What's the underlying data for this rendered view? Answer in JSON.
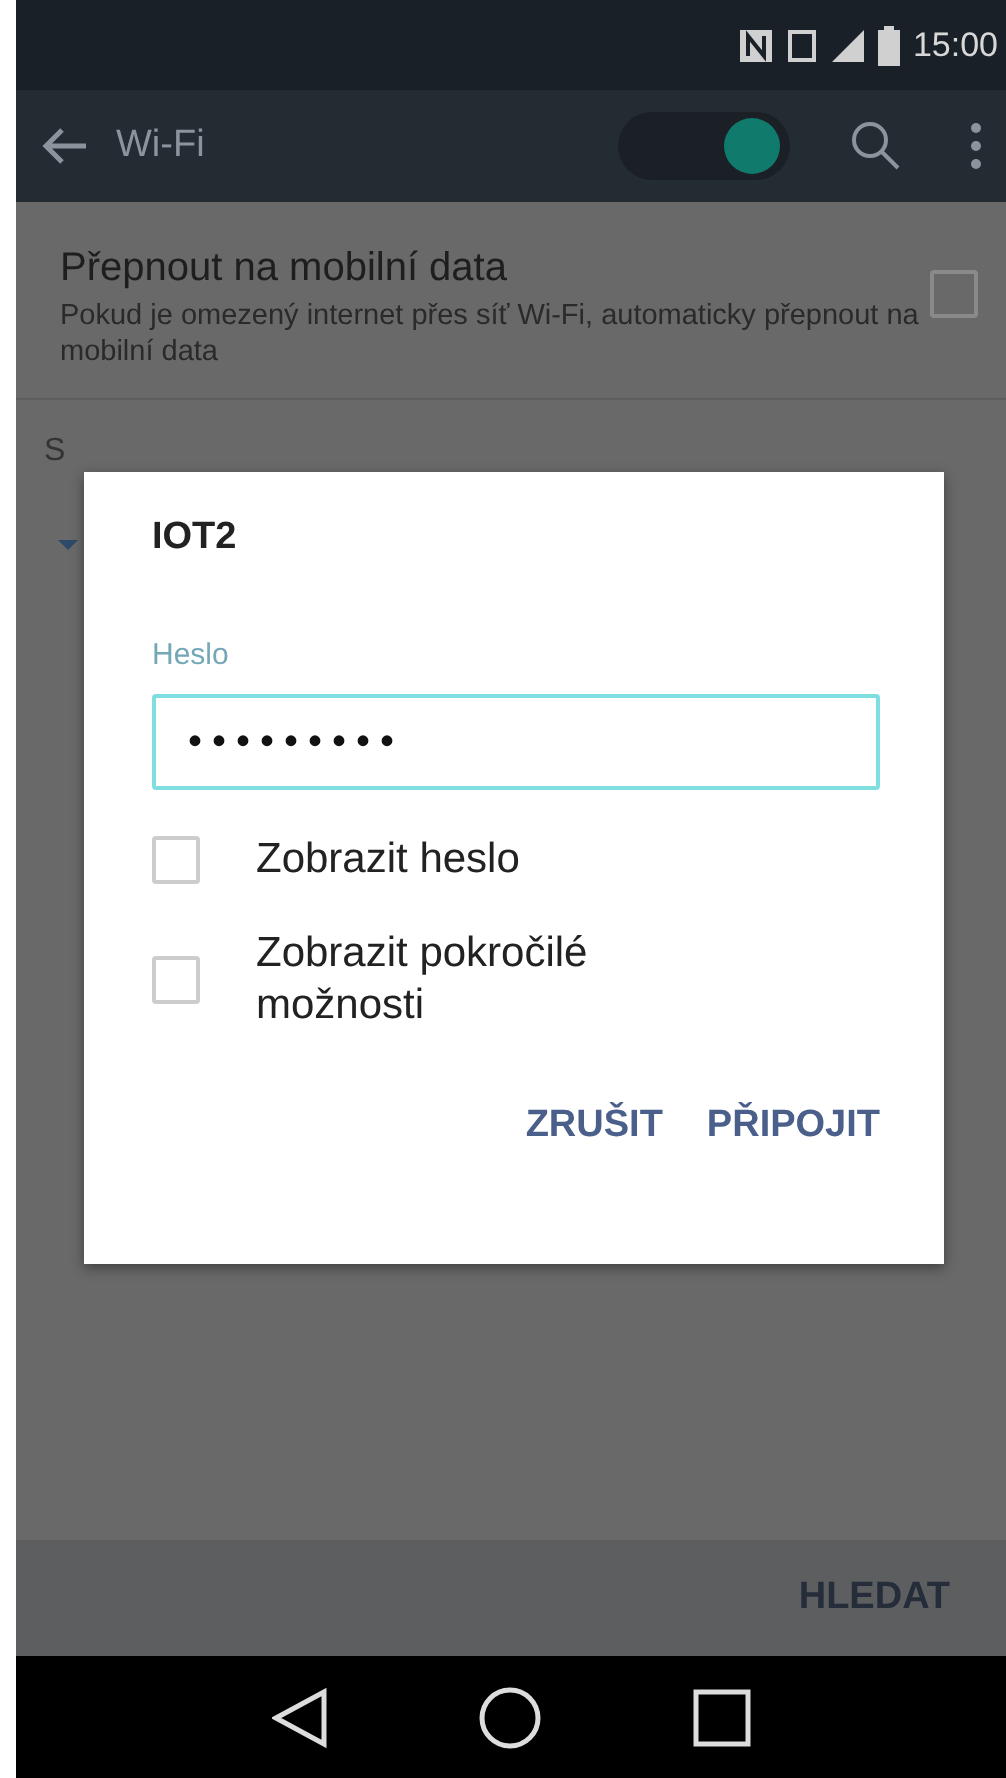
{
  "status_bar": {
    "time": "15:00"
  },
  "app_bar": {
    "title": "Wi-Fi",
    "wifi_on": true
  },
  "settings": [
    {
      "title": "Přepnout na mobilní data",
      "summary": "Pokud je omezený internet přes síť Wi-Fi, automaticky přepnout na mobilní data",
      "checked": false
    }
  ],
  "section_header": "S",
  "dialog": {
    "title": "IOT2",
    "field_label": "Heslo",
    "value": "•••••••••",
    "options": [
      {
        "label": "Zobrazit heslo",
        "checked": false
      },
      {
        "label": "Zobrazit pokročilé možnosti",
        "checked": false
      }
    ],
    "buttons": [
      "ZRUŠIT",
      "PŘIPOJIT"
    ]
  },
  "bottom_bar": {
    "button": "HLEDAT"
  }
}
